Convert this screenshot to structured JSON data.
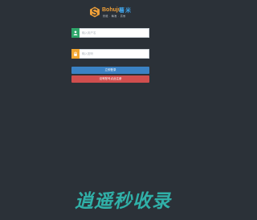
{
  "header": {
    "logo_text": "Bohuju",
    "logo_cn": "薯米",
    "tagline": "智能 · 精准 · 高效"
  },
  "login_form": {
    "username_placeholder": "输入用户名",
    "password_placeholder": "输入密码",
    "login_label": "立即登录",
    "register_label": "没有账号点此注册"
  },
  "watermark": {
    "text": "逍遥秒收录"
  },
  "colors": {
    "background": "#2b3138",
    "user_icon_bg": "#2fa66a",
    "password_icon_bg": "#f0a530",
    "login_button": "#3b82c4",
    "register_button": "#d04e4e",
    "watermark": "#30b0a8"
  },
  "icons": {
    "username": "user-icon",
    "password": "lock-icon",
    "logo": "s-logo-icon"
  }
}
